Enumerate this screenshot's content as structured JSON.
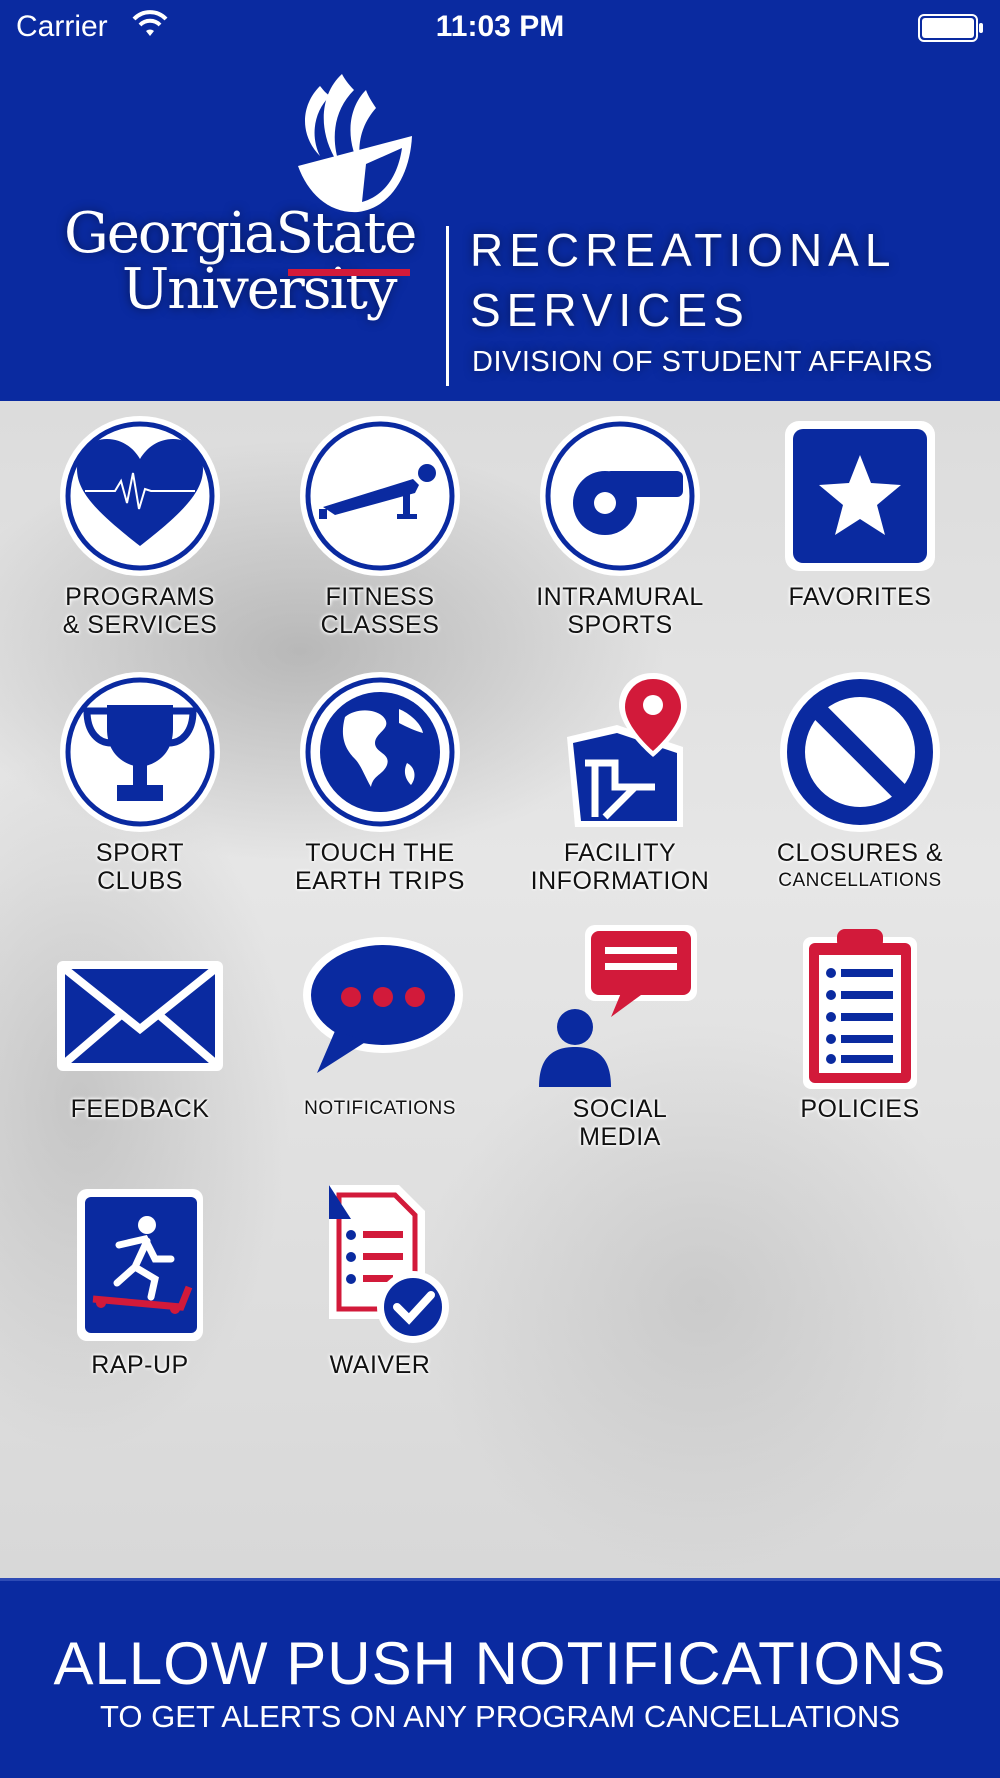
{
  "status_bar": {
    "carrier": "Carrier",
    "time": "11:03 PM",
    "icons": [
      "wifi-icon",
      "battery-icon"
    ]
  },
  "header": {
    "university_line1": "GeorgiaState",
    "university_line2": "University",
    "department_line1": "RECREATIONAL",
    "department_line2": "SERVICES",
    "division": "DIVISION OF STUDENT AFFAIRS"
  },
  "menu": {
    "programs": {
      "line1": "PROGRAMS",
      "line2": "& SERVICES",
      "icon": "heart-pulse-icon"
    },
    "fitness": {
      "line1": "FITNESS",
      "line2": "CLASSES",
      "icon": "pushup-icon"
    },
    "intramural": {
      "line1": "INTRAMURAL",
      "line2": "SPORTS",
      "icon": "whistle-icon"
    },
    "favorites": {
      "line1": "FAVORITES",
      "icon": "star-icon"
    },
    "sport_clubs": {
      "line1": "SPORT",
      "line2": "CLUBS",
      "icon": "trophy-icon"
    },
    "earth_trips": {
      "line1": "TOUCH THE",
      "line2": "EARTH TRIPS",
      "icon": "globe-icon"
    },
    "facility": {
      "line1": "FACILITY",
      "line2": "INFORMATION",
      "icon": "map-pin-icon"
    },
    "closures": {
      "line1": "CLOSURES &",
      "line2": "CANCELLATIONS",
      "icon": "prohibited-icon"
    },
    "feedback": {
      "line1": "FEEDBACK",
      "icon": "envelope-icon"
    },
    "notifications": {
      "line1": "NOTIFICATIONS",
      "icon": "chat-bubble-icon"
    },
    "social": {
      "line1": "SOCIAL",
      "line2": "MEDIA",
      "icon": "social-person-icon"
    },
    "policies": {
      "line1": "POLICIES",
      "icon": "clipboard-icon"
    },
    "rapup": {
      "line1": "RAP-UP",
      "icon": "treadmill-runner-icon"
    },
    "waiver": {
      "line1": "WAIVER",
      "icon": "document-check-icon"
    }
  },
  "footer": {
    "headline": "ALLOW PUSH NOTIFICATIONS",
    "subtext": "TO GET ALERTS ON ANY PROGRAM CANCELLATIONS"
  },
  "colors": {
    "brand_blue": "#0a2aa0",
    "brand_red": "#d21a3a",
    "icon_white": "#ffffff"
  }
}
